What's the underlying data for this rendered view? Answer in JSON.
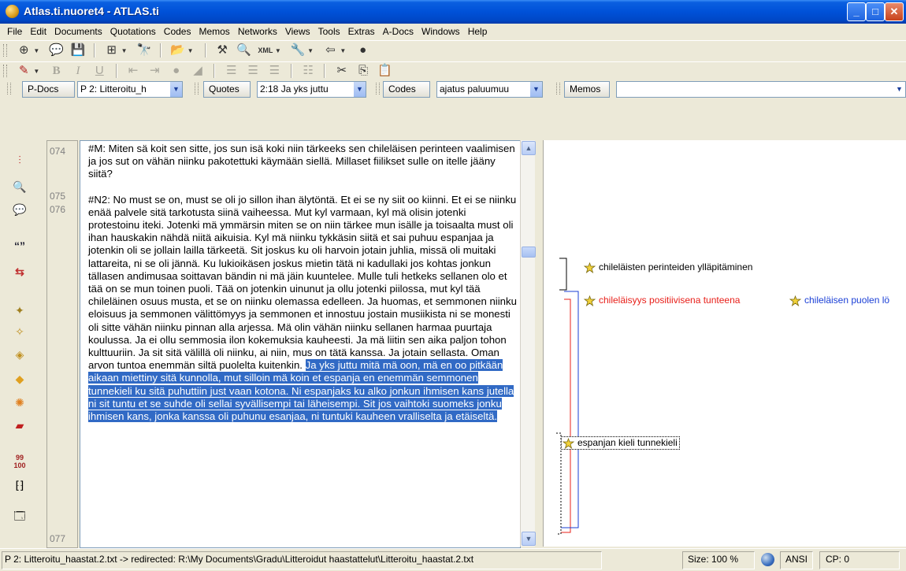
{
  "window": {
    "title": "Atlas.ti.nuoret4 - ATLAS.ti"
  },
  "menu": [
    "File",
    "Edit",
    "Documents",
    "Quotations",
    "Codes",
    "Memos",
    "Networks",
    "Views",
    "Tools",
    "Extras",
    "A-Docs",
    "Windows",
    "Help"
  ],
  "nav": {
    "pdocs_label": "P-Docs",
    "pdocs_value": "P 2: Litteroitu_h",
    "quotes_label": "Quotes",
    "quotes_value": "2:18 Ja yks juttu",
    "codes_label": "Codes",
    "codes_value": "ajatus paluumuu",
    "memos_label": "Memos",
    "memos_value": ""
  },
  "line_numbers": [
    "074",
    "075",
    "076",
    "077"
  ],
  "document": {
    "para1": "#M: Miten sä koit sen sitte, jos sun isä koki niin tärkeeks sen chileläisen perinteen vaalimisen ja jos sut on vähän niinku pakotettuki käymään siellä. Millaset fiilikset sulle on itelle jääny siitä?",
    "para2": "#N2: No must se on, must se oli jo sillon ihan älytöntä. Et ei se ny siit oo kiinni. Et ei se niinku enää palvele sitä tarkotusta siinä vaiheessa. Mut kyl varmaan, kyl mä olisin jotenki protestoinu iteki. Jotenki mä ymmärsin miten se on niin tärkee mun isälle ja toisaalta must oli ihan hauskakin nähdä niitä aikuisia. Kyl mä niinku tykkäsin siitä et sai puhuu espanjaa ja jotenkin oli se jollain lailla tärkeetä. Sit joskus ku oli harvoin jotain juhlia, missä oli muitaki lattareita, ni se oli jännä. Ku lukioikäsen joskus mietin tätä ni kadullaki jos kohtas jonkun tällasen andimusaa soittavan bändin ni mä jäin kuuntelee. Mulle tuli hetkeks sellanen olo et tää on se mun toinen puoli. Tää on jotenkin uinunut ja ollu jotenki piilossa, mut kyl tää chileläinen osuus musta, et se on niinku olemassa edelleen. Ja huomas, et semmonen niinku eloisuus ja semmonen välittömyys ja semmonen et innostuu jostain musiikista ni se monesti oli sitte vähän niinku pinnan alla arjessa. Mä olin vähän niinku sellanen harmaa puurtaja koulussa. Ja ei ollu semmosia ilon kokemuksia kauheesti. Ja mä liitin sen aika paljon tohon kulttuuriin. Ja sit sitä välillä oli niinku, ai niin, mus on tätä kanssa. Ja jotain sellasta. Oman arvon tuntoa enemmän siltä puolelta kuitenkin.",
    "para2_selected": "Ja yks juttu mitä mä oon, mä en oo pitkään aikaan miettiny sitä kunnolla, mut silloin mä koin et espanja en enemmän semmonen tunnekieli ku sitä puhuttiin just vaan kotona. Ni espanjaks ku alko jonkun ihmisen kans jutella ni sit tuntu et se suhde oli sellai syvällisempi tai läheisempi. Sit jos vaihtoki suomeks jonku ihmisen kans, jonka kanssa oli puhunu esanjaa, ni tuntuki kauheen vralliselta ja etäiseltä."
  },
  "codes": [
    {
      "label": "chileläisten perinteiden ylläpitäminen",
      "color": "#000000"
    },
    {
      "label": "chileläisyys positiivisena tunteena",
      "color": "#e8201a"
    },
    {
      "label": "chileläisen puolen lö",
      "color": "#1a3fd6"
    },
    {
      "label": "espanjan kieli tunnekieli",
      "color": "#000000"
    }
  ],
  "status": {
    "path": "P 2: Litteroitu_haastat.2.txt -> redirected: R:\\My Documents\\Gradu\\Litteroidut haastattelut\\Litteroitu_haastat.2.txt",
    "size": "Size: 100 %",
    "encoding": "ANSI",
    "cp": "CP: 0"
  }
}
